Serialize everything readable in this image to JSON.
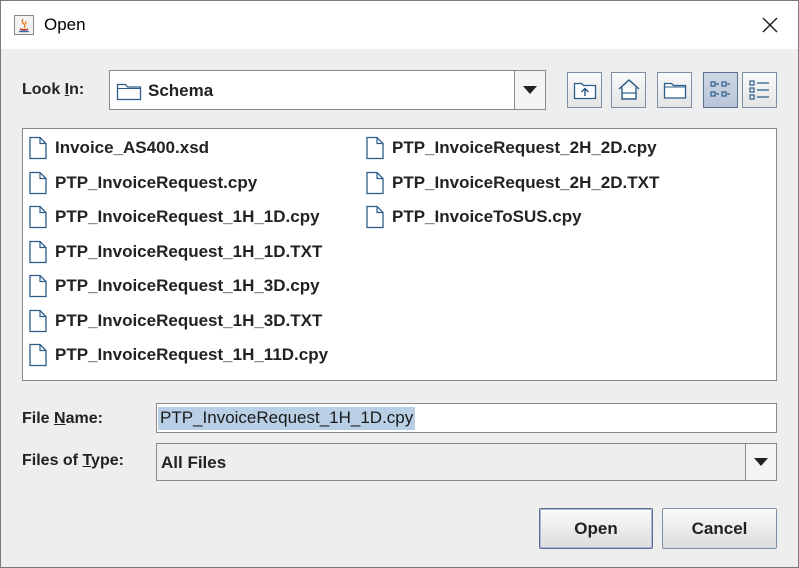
{
  "window": {
    "title": "Open",
    "close_symbol": "✕"
  },
  "look_in": {
    "label_prefix": "Look ",
    "label_mnemonic": "I",
    "label_suffix": "n:",
    "value": "Schema",
    "icon": "folder-icon"
  },
  "toolbar": [
    {
      "name": "up-one-level-button",
      "icon": "up-folder-icon"
    },
    {
      "name": "home-button",
      "icon": "home-icon"
    },
    {
      "name": "new-folder-button",
      "icon": "new-folder-icon"
    },
    {
      "name": "list-view-button",
      "icon": "list-view-icon",
      "pressed": true
    },
    {
      "name": "details-view-button",
      "icon": "details-view-icon",
      "pressed": false
    }
  ],
  "files": [
    "Invoice_AS400.xsd",
    "PTP_InvoiceRequest.cpy",
    "PTP_InvoiceRequest_1H_1D.cpy",
    "PTP_InvoiceRequest_1H_1D.TXT",
    "PTP_InvoiceRequest_1H_3D.cpy",
    "PTP_InvoiceRequest_1H_3D.TXT",
    "PTP_InvoiceRequest_1H_11D.cpy",
    "PTP_InvoiceRequest_2H_2D.cpy",
    "PTP_InvoiceRequest_2H_2D.TXT",
    "PTP_InvoiceToSUS.cpy"
  ],
  "file_name": {
    "label_prefix": "File ",
    "label_mnemonic": "N",
    "label_suffix": "ame:",
    "value": "PTP_InvoiceRequest_1H_1D.cpy"
  },
  "file_type": {
    "label_prefix": "Files of ",
    "label_mnemonic": "T",
    "label_suffix": "ype:",
    "value": "All Files"
  },
  "buttons": {
    "open": "Open",
    "cancel": "Cancel"
  },
  "colors": {
    "selection": "#b8cfe5",
    "button_border": "#7c8ea4",
    "icon_blue": "#2b5c8a"
  }
}
